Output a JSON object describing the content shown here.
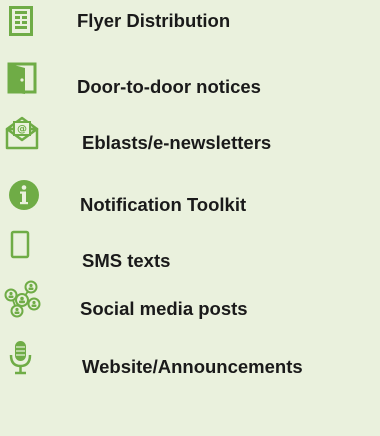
{
  "accent_color": "#6fac46",
  "items": [
    {
      "label": "Flyer Distribution",
      "icon": "flyer-icon"
    },
    {
      "label": "Door-to-door notices",
      "icon": "door-icon"
    },
    {
      "label": "Eblasts/e-newsletters",
      "icon": "email-envelope-icon"
    },
    {
      "label": "Notification Toolkit",
      "icon": "info-icon"
    },
    {
      "label": "SMS texts",
      "icon": "mobile-phone-icon"
    },
    {
      "label": "Social media posts",
      "icon": "social-network-icon"
    },
    {
      "label": "Website/Announcements",
      "icon": "microphone-icon"
    }
  ]
}
